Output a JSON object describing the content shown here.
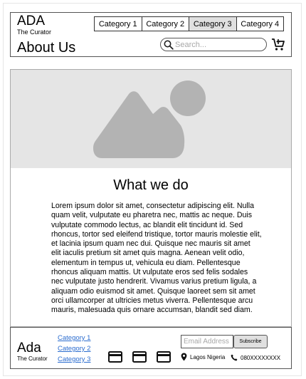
{
  "header": {
    "logo_title": "ADA",
    "logo_subtitle": "The Curator",
    "page_title": "About Us",
    "tabs": [
      {
        "label": "Category 1",
        "active": false
      },
      {
        "label": "Category 2",
        "active": false
      },
      {
        "label": "Category 3",
        "active": true
      },
      {
        "label": "Category 4",
        "active": false
      }
    ],
    "search": {
      "placeholder": "Search...",
      "value": "",
      "icon": "search-icon"
    },
    "cart_icon": "cart-icon"
  },
  "main": {
    "hero_icon": "image-placeholder-icon",
    "section_title": "What we do",
    "body": "Lorem ipsum dolor sit amet, consectetur adipiscing elit. Nulla quam velit, vulputate eu pharetra nec, mattis ac neque. Duis vulputate commodo lectus, ac blandit elit tincidunt id. Sed rhoncus, tortor sed eleifend tristique, tortor mauris molestie elit, et lacinia ipsum quam nec dui. Quisque nec mauris sit amet elit iaculis pretium sit amet quis magna. Aenean velit odio, elementum in tempus ut, vehicula eu diam. Pellentesque rhoncus aliquam mattis. Ut vulputate eros sed felis sodales nec vulputate justo hendrerit. Vivamus varius pretium ligula, a aliquam odio euismod sit amet. Quisque laoreet sem sit amet orci ullamcorper at ultricies metus viverra. Pellentesque arcu mauris, malesuada quis ornare accumsan, blandit sed diam."
  },
  "footer": {
    "logo_title": "Ada",
    "logo_subtitle": "The Curator",
    "links": [
      "Category 1",
      "Category 2",
      "Category 3"
    ],
    "payment_icons": [
      "credit-card-icon",
      "credit-card-icon",
      "credit-card-icon"
    ],
    "email_placeholder": "Email Address",
    "subscribe_label": "Subscribe",
    "location": "Lagos Nigeria",
    "phone": "080XXXXXXXX"
  },
  "colors": {
    "link": "#2a6ccf",
    "hero_bg": "#e5e5e5",
    "hero_shape": "#b3b3b3",
    "active_tab": "#e0e0e0"
  }
}
